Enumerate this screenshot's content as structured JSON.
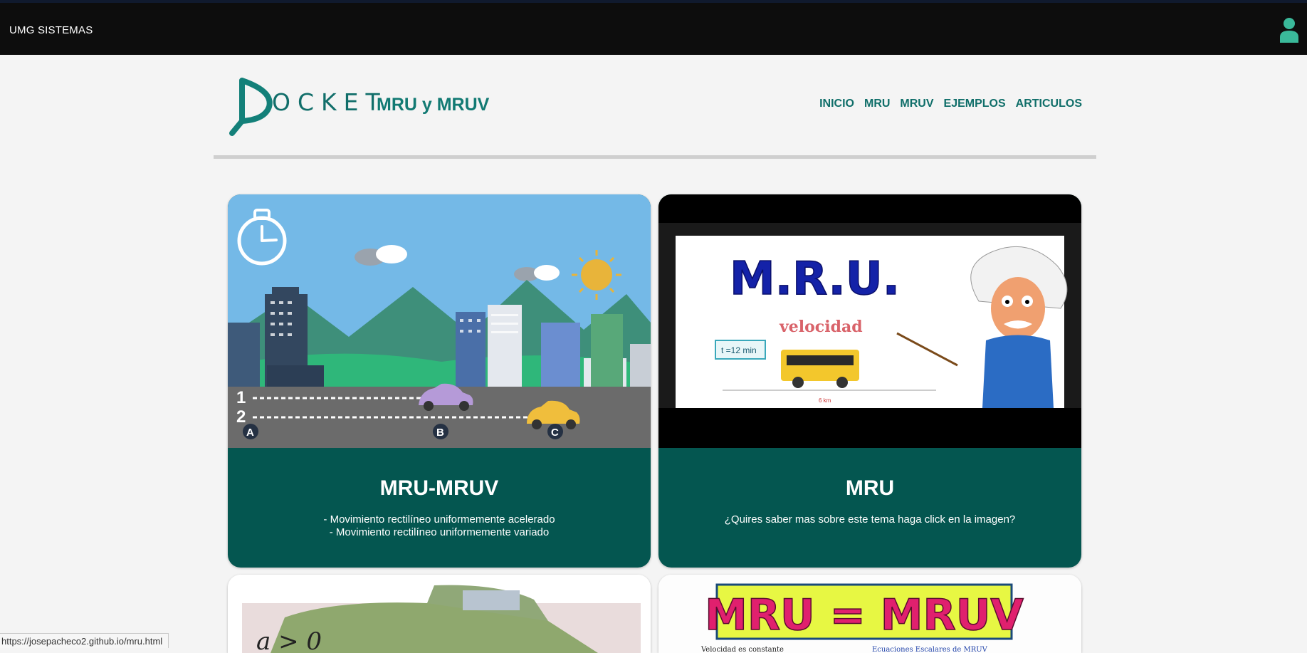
{
  "topbar": {
    "brand": "UMG SISTEMAS",
    "user_icon": "user-icon",
    "accent": "#3ab99a"
  },
  "header": {
    "logo_text": "OCKET",
    "title": "MRU y MRUV",
    "nav": [
      "INICIO",
      "MRU",
      "MRUV",
      "EJEMPLOS",
      "ARTICULOS"
    ],
    "color": "#127a73"
  },
  "cards": [
    {
      "title": "MRU-MRUV",
      "lines": [
        "- Movimiento rectilíneo uniformemente acelerado",
        "- Movimiento rectilíneo uniformemente variado"
      ],
      "image_labels": [
        "1",
        "2",
        "A",
        "B",
        "C"
      ]
    },
    {
      "title": "MRU",
      "lines": [
        "¿Quires saber mas sobre este tema haga click en la imagen?"
      ],
      "image_labels": [
        "M.R.U.",
        "velocidad",
        "t =12 min",
        "6 km"
      ]
    }
  ],
  "lower_cards": [
    {
      "image_labels": [
        "a > 0"
      ]
    },
    {
      "image_labels": [
        "MRU = MRUV",
        "Velocidad es constante",
        "Ecuaciones Escalares de MRUV"
      ]
    }
  ],
  "status_bar": {
    "url": "https://josepacheco2.github.io/mru.html"
  },
  "colors": {
    "topbar": "#0d0d0d",
    "card": "#045650",
    "background": "#f4f4f4"
  }
}
